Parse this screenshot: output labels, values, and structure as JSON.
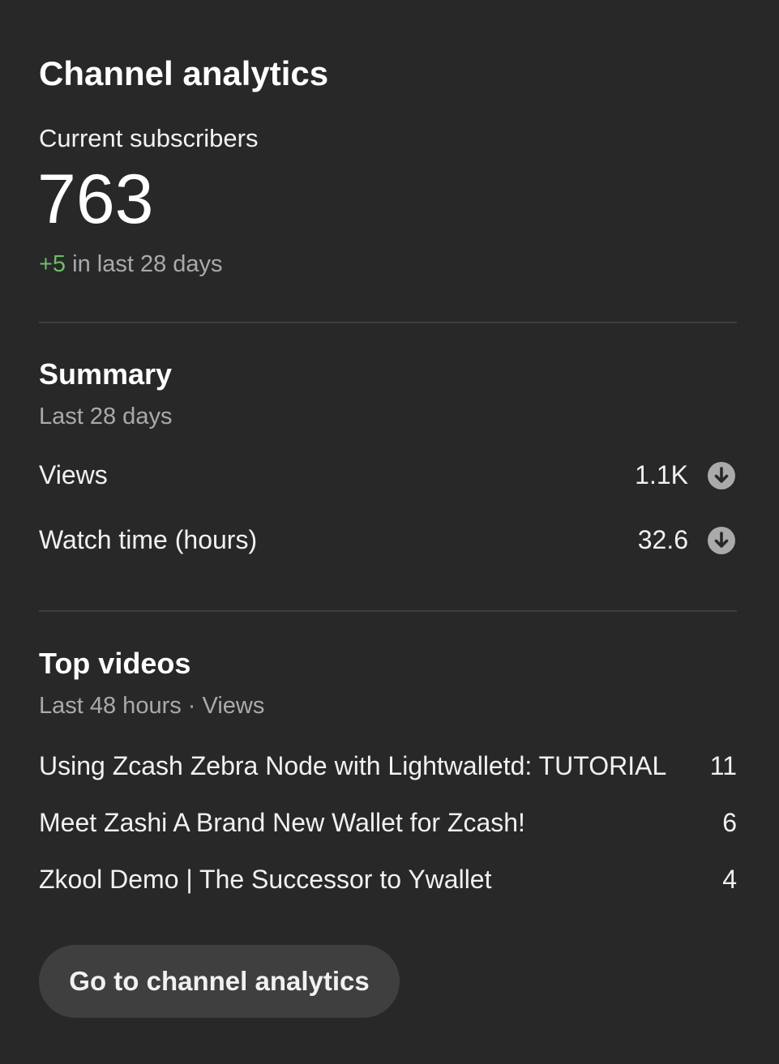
{
  "card": {
    "title": "Channel analytics"
  },
  "subscribers": {
    "label": "Current subscribers",
    "count": "763",
    "delta_value": "+5",
    "delta_suffix": " in last 28 days",
    "delta_color": "#6fba6a"
  },
  "summary": {
    "title": "Summary",
    "period": "Last 28 days",
    "metrics": [
      {
        "label": "Views",
        "value": "1.1K",
        "trend_icon": "arrow-down-circle-icon"
      },
      {
        "label": "Watch time (hours)",
        "value": "32.6",
        "trend_icon": "arrow-down-circle-icon"
      }
    ]
  },
  "top_videos": {
    "title": "Top videos",
    "subtitle": "Last 48 hours · Views",
    "items": [
      {
        "title": "Using Zcash Zebra Node with Lightwalletd: TUTORIAL",
        "views": "11"
      },
      {
        "title": "Meet Zashi A Brand New Wallet for Zcash!",
        "views": "6"
      },
      {
        "title": "Zkool Demo | The Successor to Ywallet",
        "views": "4"
      }
    ]
  },
  "cta": {
    "label": "Go to channel analytics"
  }
}
